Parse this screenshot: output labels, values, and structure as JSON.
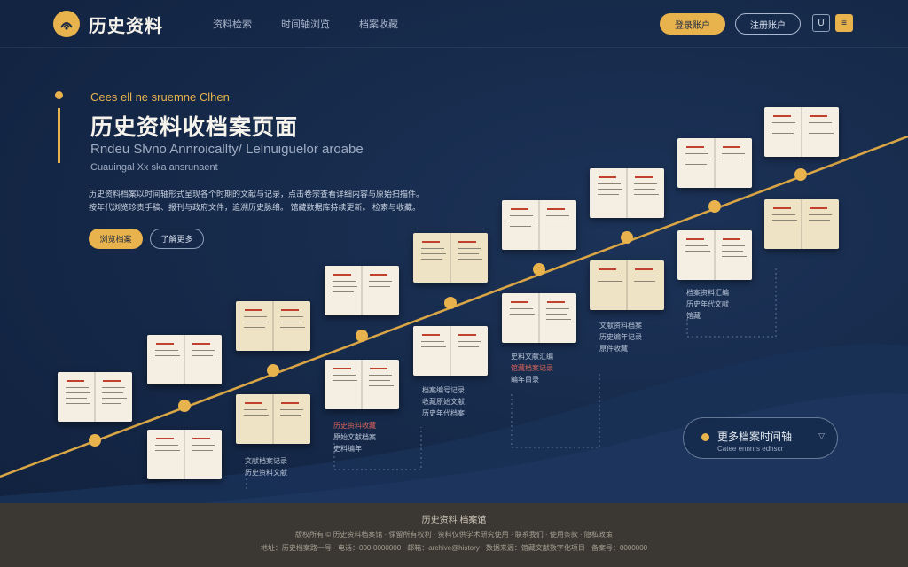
{
  "header": {
    "logo_text": "历史资料",
    "nav": [
      "资料检索",
      "时间轴浏览",
      "档案收藏"
    ],
    "primary_button": "登录账户",
    "secondary_button": "注册账户",
    "icon_button_1": "U",
    "icon_button_2": "≡"
  },
  "hero": {
    "eyebrow": "Cees ell ne sruemne Clhen",
    "title": "历史资料收档案页面",
    "subtitle": "Rndeu Slvno Annroicallty/ Lelnuiguelor aroabe",
    "subtitle2": "Cuauingal Xx ska ansrunaent",
    "description": [
      "历史资料档案以时间轴形式呈现各个时期的文献与记录，点击卷宗查看详细内容与原始扫描件。",
      "按年代浏览珍贵手稿、报刊与政府文件，追溯历史脉络。  馆藏数据库持续更新。  检索与收藏。"
    ],
    "primary_button": "浏览档案",
    "secondary_button": "了解更多"
  },
  "entries": [
    {
      "lines": [
        "文献档案记录",
        "历史资料文献"
      ]
    },
    {
      "lines": [
        "历史资料收藏",
        "原始文献档案",
        "史料编年"
      ]
    },
    {
      "lines": [
        "档案编号记录",
        "收藏原始文献",
        "历史年代档案"
      ]
    },
    {
      "lines": [
        "史料文献汇编",
        "馆藏档案记录",
        "编年目录"
      ]
    },
    {
      "lines": [
        "文献资料档案",
        "历史编年记录",
        "原件收藏"
      ]
    },
    {
      "lines": [
        "档案资料汇编",
        "历史年代文献",
        "馆藏"
      ]
    }
  ],
  "search": {
    "title": "更多档案时间轴",
    "subtitle": "Catee ennnrs edhscr",
    "chevron_icon": "chevron-down-icon"
  },
  "footer": {
    "title": "历史资料 档案馆",
    "line1": "版权所有 © 历史资料档案馆 · 保留所有权利 · 资料仅供学术研究使用 · 联系我们 · 使用条款 · 隐私政策",
    "line2": "地址：历史档案路一号 · 电话：000-0000000 · 邮箱：archive@history · 数据来源：馆藏文献数字化项目 · 备案号：0000000"
  },
  "colors": {
    "accent": "#e8b24c",
    "background": "#152848",
    "footer": "#3b3834"
  }
}
